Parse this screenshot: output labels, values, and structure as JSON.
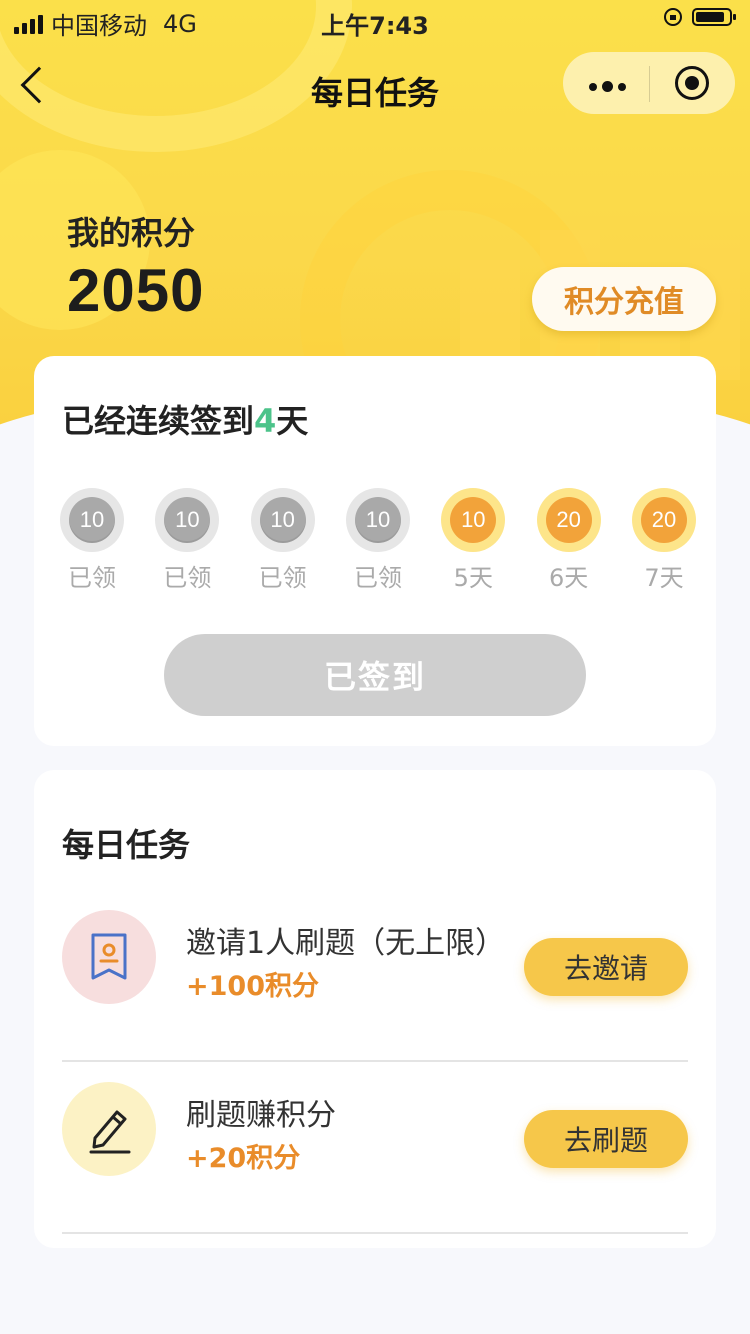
{
  "status_bar": {
    "carrier": "中国移动",
    "network": "4G",
    "time": "上午7:43"
  },
  "nav": {
    "title": "每日任务"
  },
  "points": {
    "label": "我的积分",
    "value": "2050",
    "recharge_label": "积分充值"
  },
  "checkin": {
    "prefix": "已经连续签到",
    "days": "4",
    "suffix": "天",
    "items": [
      {
        "amount": "10",
        "label": "已领",
        "claimed": true
      },
      {
        "amount": "10",
        "label": "已领",
        "claimed": true
      },
      {
        "amount": "10",
        "label": "已领",
        "claimed": true
      },
      {
        "amount": "10",
        "label": "已领",
        "claimed": true
      },
      {
        "amount": "10",
        "label": "5天",
        "claimed": false
      },
      {
        "amount": "20",
        "label": "6天",
        "claimed": false
      },
      {
        "amount": "20",
        "label": "7天",
        "claimed": false
      }
    ],
    "button_label": "已签到"
  },
  "tasks": {
    "title": "每日任务",
    "items": [
      {
        "name": "邀请1人刷题（无上限）",
        "reward": "+100积分",
        "button": "去邀请",
        "icon": "bookmark-user-icon"
      },
      {
        "name": "刷题赚积分",
        "reward": "+20积分",
        "button": "去刷题",
        "icon": "pencil-icon"
      }
    ]
  },
  "colors": {
    "accent_yellow": "#fbd84a",
    "reward_orange": "#e98c2a",
    "streak_green": "#4cc38a",
    "button_yellow": "#f6c74a"
  }
}
